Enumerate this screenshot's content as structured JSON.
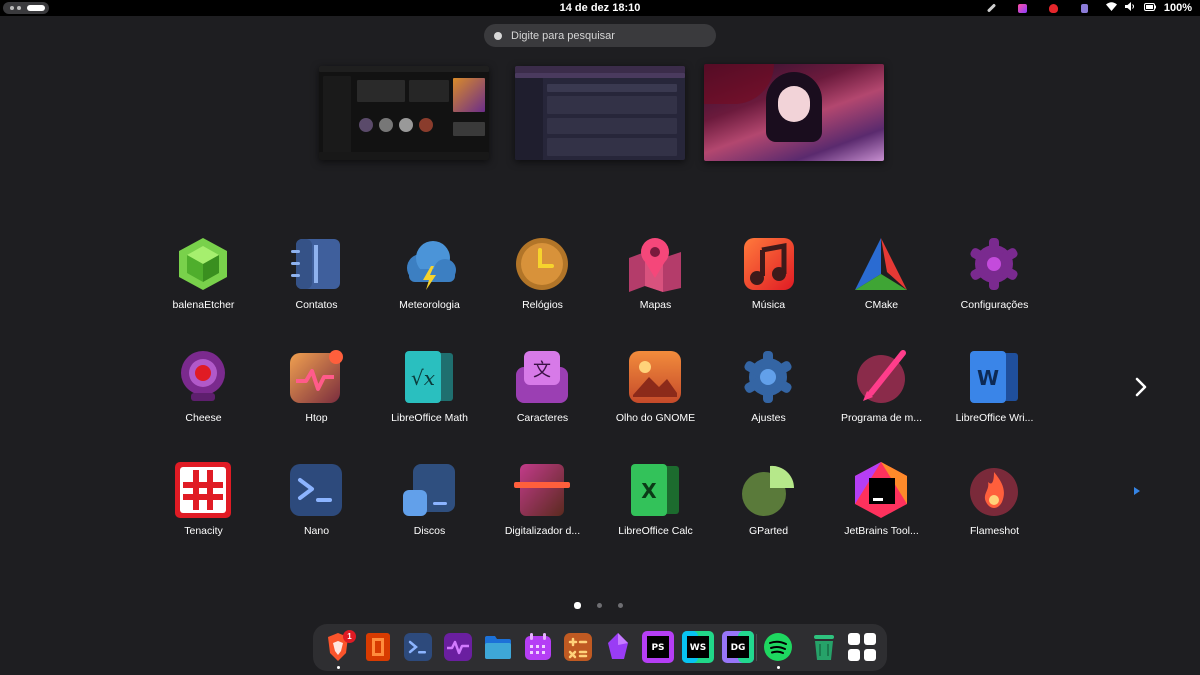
{
  "topbar": {
    "datetime": "14 de dez  18:10",
    "battery": "100%",
    "tray_icons": [
      "pen-icon",
      "craft-icon",
      "flame-icon",
      "clipboard-icon"
    ],
    "system_icons": [
      "wifi-icon",
      "volume-icon",
      "battery-icon"
    ]
  },
  "search": {
    "placeholder": "Digite para pesquisar"
  },
  "windows": [
    {
      "name": "music-player-window"
    },
    {
      "name": "web-app-window"
    },
    {
      "name": "anime-wallpaper-window"
    }
  ],
  "apps": [
    {
      "label": "balenaEtcher",
      "icon": "balena-etcher-icon"
    },
    {
      "label": "Contatos",
      "icon": "contacts-icon"
    },
    {
      "label": "Meteorologia",
      "icon": "weather-icon"
    },
    {
      "label": "Relógios",
      "icon": "clocks-icon"
    },
    {
      "label": "Mapas",
      "icon": "maps-icon"
    },
    {
      "label": "Música",
      "icon": "music-icon"
    },
    {
      "label": "CMake",
      "icon": "cmake-icon"
    },
    {
      "label": "Configurações",
      "icon": "settings-icon"
    },
    {
      "label": "Cheese",
      "icon": "webcam-icon"
    },
    {
      "label": "Htop",
      "icon": "htop-icon"
    },
    {
      "label": "LibreOffice Math",
      "icon": "libreoffice-math-icon"
    },
    {
      "label": "Caracteres",
      "icon": "characters-icon"
    },
    {
      "label": "Olho do GNOME",
      "icon": "image-viewer-icon"
    },
    {
      "label": "Ajustes",
      "icon": "tweaks-icon"
    },
    {
      "label": "Programa de m...",
      "icon": "paint-icon"
    },
    {
      "label": "LibreOffice Wri...",
      "icon": "libreoffice-writer-icon"
    },
    {
      "label": "Tenacity",
      "icon": "tenacity-icon"
    },
    {
      "label": "Nano",
      "icon": "nano-icon"
    },
    {
      "label": "Discos",
      "icon": "disks-icon"
    },
    {
      "label": "Digitalizador d...",
      "icon": "scanner-icon"
    },
    {
      "label": "LibreOffice Calc",
      "icon": "libreoffice-calc-icon"
    },
    {
      "label": "GParted",
      "icon": "gparted-icon"
    },
    {
      "label": "JetBrains Tool...",
      "icon": "jetbrains-toolbox-icon"
    },
    {
      "label": "Flameshot",
      "icon": "flameshot-icon"
    }
  ],
  "pagination": {
    "pages": 3,
    "current": 1
  },
  "dock": {
    "items": [
      "brave-icon",
      "office-icon",
      "terminal-icon",
      "activity-monitor-icon",
      "files-icon",
      "calendar-icon",
      "calculator-icon",
      "gem-icon",
      "phpstorm-icon",
      "webstorm-icon",
      "datagrip-icon",
      "spotify-icon",
      "trash-icon",
      "show-apps-icon"
    ],
    "brave_badge": "1",
    "running": [
      "brave-icon",
      "spotify-icon"
    ]
  },
  "colors": {
    "background": "#1e1e21",
    "topbar": "#000000",
    "dock": "#2e2e31"
  }
}
